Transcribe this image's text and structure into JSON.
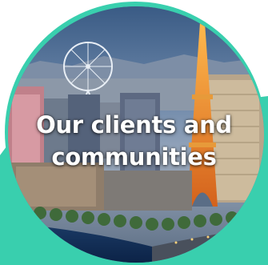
{
  "heading": {
    "line1": "Our clients and",
    "line2": "communities"
  },
  "colors": {
    "accent_teal": "#39cfae",
    "caption_text": "#ffffff"
  },
  "image": {
    "subject": "las-vegas-strip-skyline"
  }
}
